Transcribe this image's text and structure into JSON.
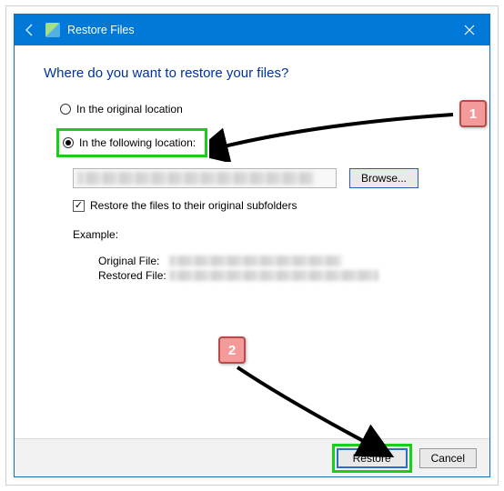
{
  "titlebar": {
    "title": "Restore Files"
  },
  "heading": "Where do you want to restore your files?",
  "options": {
    "original": "In the original location",
    "following": "In the following location:"
  },
  "browse_label": "Browse...",
  "checkbox_label": "Restore the files to their original subfolders",
  "example_label": "Example:",
  "example": {
    "original_label": "Original File:",
    "restored_label": "Restored File:"
  },
  "footer": {
    "restore": "Restore",
    "cancel": "Cancel"
  },
  "annotations": {
    "step1": "1",
    "step2": "2"
  }
}
